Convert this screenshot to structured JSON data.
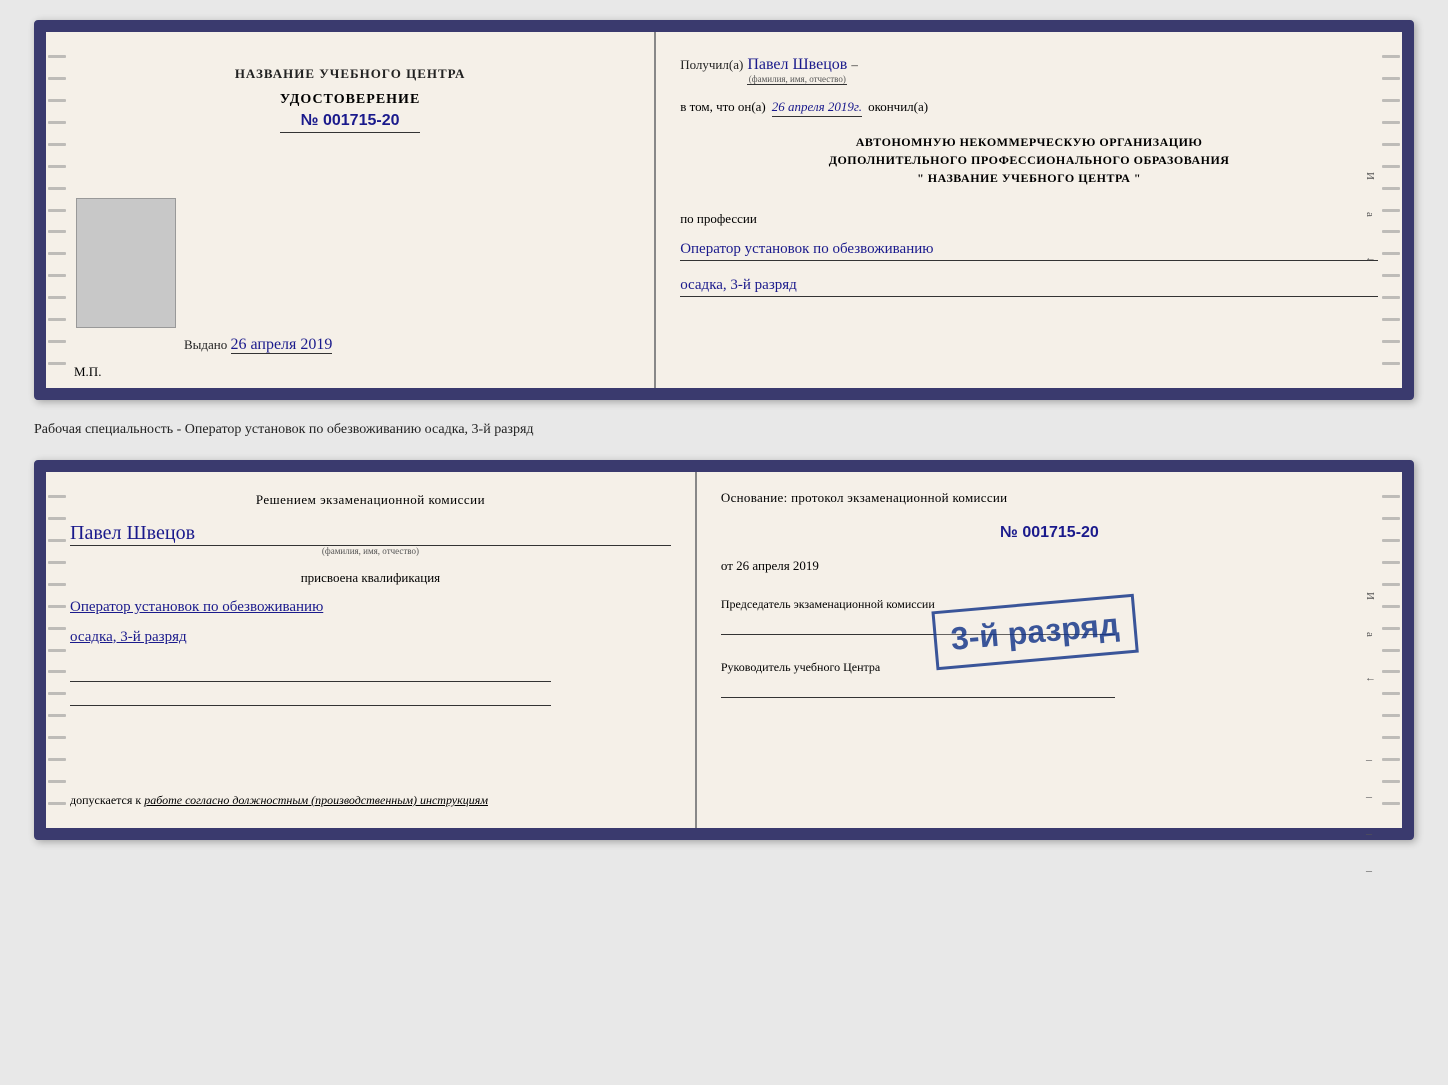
{
  "doc1": {
    "left": {
      "center_title": "НАЗВАНИЕ УЧЕБНОГО ЦЕНТРА",
      "udostoverenie": "УДОСТОВЕРЕНИЕ",
      "number_prefix": "№",
      "number": "001715-20",
      "vydano_label": "Выдано",
      "vydano_date": "26 апреля 2019",
      "mp": "М.П."
    },
    "right": {
      "poluchil": "Получил(а)",
      "fio": "Павел Швецов",
      "fio_sub": "(фамилия, имя, отчество)",
      "dash": "–",
      "vtom": "в том, что он(а)",
      "date_handwritten": "26 апреля 2019г.",
      "okончил": "окончил(а)",
      "avtonom1": "АВТОНОМНУЮ НЕКОММЕРЧЕСКУЮ ОРГАНИЗАЦИЮ",
      "avtonom2": "ДОПОЛНИТЕЛЬНОГО ПРОФЕССИОНАЛЬНОГО ОБРАЗОВАНИЯ",
      "avtonom3": "\"    НАЗВАНИЕ УЧЕБНОГО ЦЕНТРА    \"",
      "po_professii": "по профессии",
      "profession": "Оператор установок по обезвоживанию",
      "razryad": "осадка, 3-й разряд",
      "i_label": "И",
      "a_label": "а",
      "arrow_label": "←"
    }
  },
  "middle_text": "Рабочая специальность - Оператор установок по обезвоживанию осадка, 3-й разряд",
  "doc2": {
    "left": {
      "resheniem": "Решением экзаменационной комиссии",
      "fio": "Павел Швецов",
      "fio_sub": "(фамилия, имя, отчество)",
      "prisvoena": "присвоена квалификация",
      "qualification": "Оператор установок по обезвоживанию",
      "razryad": "осадка, 3-й разряд",
      "dopuskaetsya": "допускается к",
      "dopusk_text": "работе согласно должностным (производственным) инструкциям"
    },
    "right": {
      "osnovanie": "Основание: протокол экзаменационной комиссии",
      "number_prefix": "№",
      "number": "001715-20",
      "ot_prefix": "от",
      "ot_date": "26 апреля 2019",
      "predsedatel": "Председатель экзаменационной комиссии",
      "rukovoditel": "Руководитель учебного Центра"
    },
    "stamp": "3-й разряд"
  }
}
